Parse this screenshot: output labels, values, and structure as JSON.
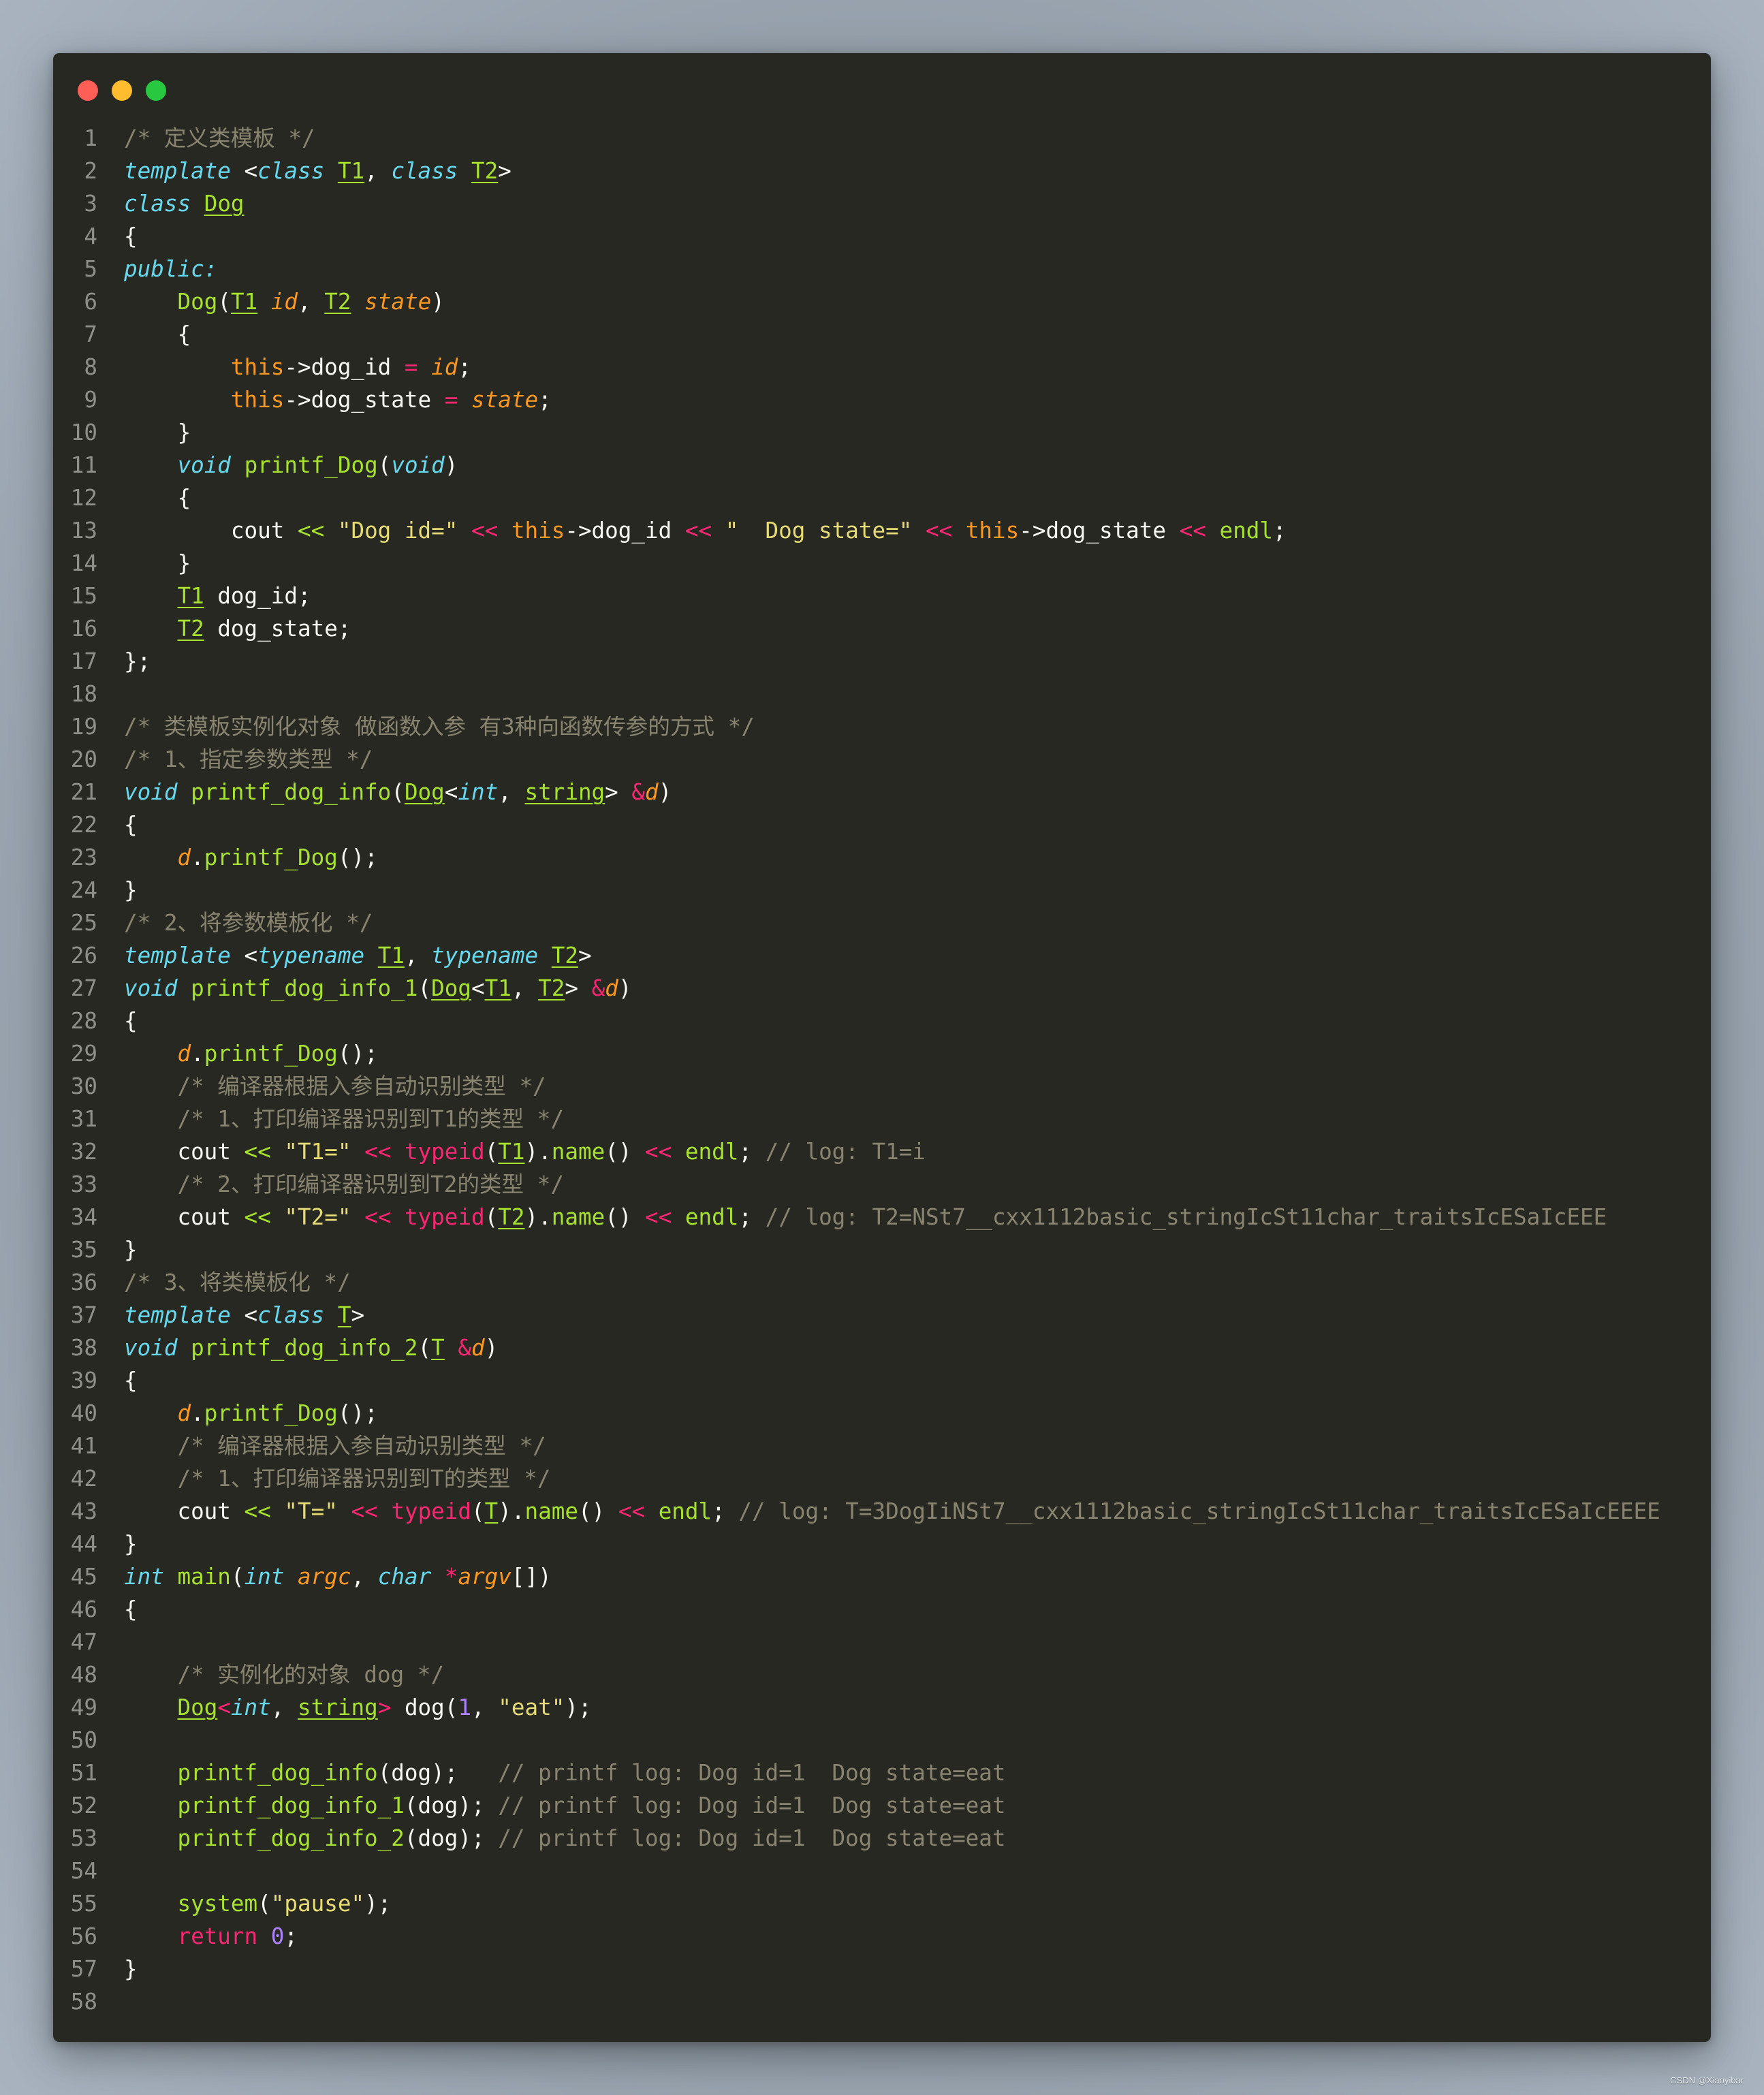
{
  "window": {
    "controls": [
      {
        "name": "close",
        "color": "#ff5f57"
      },
      {
        "name": "minimize",
        "color": "#febc2e"
      },
      {
        "name": "maximize",
        "color": "#28c840"
      }
    ]
  },
  "watermark": "CSDN @Xiaoyibar",
  "code": [
    [
      {
        "t": "/* 定义类模板 */",
        "c": "cm"
      }
    ],
    [
      {
        "t": "template",
        "c": "kw"
      },
      {
        "t": " <",
        "c": "pl"
      },
      {
        "t": "class",
        "c": "kw"
      },
      {
        "t": " ",
        "c": "pl"
      },
      {
        "t": "T1",
        "c": "ul"
      },
      {
        "t": ", ",
        "c": "pl"
      },
      {
        "t": "class",
        "c": "kw"
      },
      {
        "t": " ",
        "c": "pl"
      },
      {
        "t": "T2",
        "c": "ul"
      },
      {
        "t": ">",
        "c": "pl"
      }
    ],
    [
      {
        "t": "class",
        "c": "kw"
      },
      {
        "t": " ",
        "c": "pl"
      },
      {
        "t": "Dog",
        "c": "ul"
      }
    ],
    [
      {
        "t": "{",
        "c": "pl"
      }
    ],
    [
      {
        "t": "public:",
        "c": "kw"
      }
    ],
    [
      {
        "t": "    ",
        "c": "pl"
      },
      {
        "t": "Dog",
        "c": "fn"
      },
      {
        "t": "(",
        "c": "pl"
      },
      {
        "t": "T1",
        "c": "ul"
      },
      {
        "t": " ",
        "c": "pl"
      },
      {
        "t": "id",
        "c": "param"
      },
      {
        "t": ", ",
        "c": "pl"
      },
      {
        "t": "T2",
        "c": "ul"
      },
      {
        "t": " ",
        "c": "pl"
      },
      {
        "t": "state",
        "c": "param"
      },
      {
        "t": ")",
        "c": "pl"
      }
    ],
    [
      {
        "t": "    {",
        "c": "pl"
      }
    ],
    [
      {
        "t": "        ",
        "c": "pl"
      },
      {
        "t": "this",
        "c": "th"
      },
      {
        "t": "->dog_id ",
        "c": "pl"
      },
      {
        "t": "=",
        "c": "op"
      },
      {
        "t": " ",
        "c": "pl"
      },
      {
        "t": "id",
        "c": "param"
      },
      {
        "t": ";",
        "c": "pl"
      }
    ],
    [
      {
        "t": "        ",
        "c": "pl"
      },
      {
        "t": "this",
        "c": "th"
      },
      {
        "t": "->dog_state ",
        "c": "pl"
      },
      {
        "t": "=",
        "c": "op"
      },
      {
        "t": " ",
        "c": "pl"
      },
      {
        "t": "state",
        "c": "param"
      },
      {
        "t": ";",
        "c": "pl"
      }
    ],
    [
      {
        "t": "    }",
        "c": "pl"
      }
    ],
    [
      {
        "t": "    ",
        "c": "pl"
      },
      {
        "t": "void",
        "c": "kw"
      },
      {
        "t": " ",
        "c": "pl"
      },
      {
        "t": "printf_Dog",
        "c": "fn"
      },
      {
        "t": "(",
        "c": "pl"
      },
      {
        "t": "void",
        "c": "kw"
      },
      {
        "t": ")",
        "c": "pl"
      }
    ],
    [
      {
        "t": "    {",
        "c": "pl"
      }
    ],
    [
      {
        "t": "        cout ",
        "c": "pl"
      },
      {
        "t": "<<",
        "c": "gop"
      },
      {
        "t": " ",
        "c": "pl"
      },
      {
        "t": "\"Dog id=\"",
        "c": "str"
      },
      {
        "t": " ",
        "c": "pl"
      },
      {
        "t": "<<",
        "c": "op"
      },
      {
        "t": " ",
        "c": "pl"
      },
      {
        "t": "this",
        "c": "th"
      },
      {
        "t": "->dog_id ",
        "c": "pl"
      },
      {
        "t": "<<",
        "c": "op"
      },
      {
        "t": " ",
        "c": "pl"
      },
      {
        "t": "\"  Dog state=\"",
        "c": "str"
      },
      {
        "t": " ",
        "c": "pl"
      },
      {
        "t": "<<",
        "c": "op"
      },
      {
        "t": " ",
        "c": "pl"
      },
      {
        "t": "this",
        "c": "th"
      },
      {
        "t": "->dog_state ",
        "c": "pl"
      },
      {
        "t": "<<",
        "c": "op"
      },
      {
        "t": " ",
        "c": "pl"
      },
      {
        "t": "endl",
        "c": "fn"
      },
      {
        "t": ";",
        "c": "pl"
      }
    ],
    [
      {
        "t": "    }",
        "c": "pl"
      }
    ],
    [
      {
        "t": "    ",
        "c": "pl"
      },
      {
        "t": "T1",
        "c": "ul"
      },
      {
        "t": " dog_id;",
        "c": "pl"
      }
    ],
    [
      {
        "t": "    ",
        "c": "pl"
      },
      {
        "t": "T2",
        "c": "ul"
      },
      {
        "t": " dog_state;",
        "c": "pl"
      }
    ],
    [
      {
        "t": "};",
        "c": "pl"
      }
    ],
    [],
    [
      {
        "t": "/* 类模板实例化对象 做函数入参 有3种向函数传参的方式 */",
        "c": "cm"
      }
    ],
    [
      {
        "t": "/* 1、指定参数类型 */",
        "c": "cm"
      }
    ],
    [
      {
        "t": "void",
        "c": "kw"
      },
      {
        "t": " ",
        "c": "pl"
      },
      {
        "t": "printf_dog_info",
        "c": "fn"
      },
      {
        "t": "(",
        "c": "pl"
      },
      {
        "t": "Dog",
        "c": "ul"
      },
      {
        "t": "<",
        "c": "pl"
      },
      {
        "t": "int",
        "c": "kw"
      },
      {
        "t": ", ",
        "c": "pl"
      },
      {
        "t": "string",
        "c": "ul"
      },
      {
        "t": "> ",
        "c": "pl"
      },
      {
        "t": "&",
        "c": "op"
      },
      {
        "t": "d",
        "c": "param"
      },
      {
        "t": ")",
        "c": "pl"
      }
    ],
    [
      {
        "t": "{",
        "c": "pl"
      }
    ],
    [
      {
        "t": "    ",
        "c": "pl"
      },
      {
        "t": "d",
        "c": "param"
      },
      {
        "t": ".",
        "c": "pl"
      },
      {
        "t": "printf_Dog",
        "c": "fn"
      },
      {
        "t": "();",
        "c": "pl"
      }
    ],
    [
      {
        "t": "}",
        "c": "pl"
      }
    ],
    [
      {
        "t": "/* 2、将参数模板化 */",
        "c": "cm"
      }
    ],
    [
      {
        "t": "template",
        "c": "kw"
      },
      {
        "t": " <",
        "c": "pl"
      },
      {
        "t": "typename",
        "c": "kw"
      },
      {
        "t": " ",
        "c": "pl"
      },
      {
        "t": "T1",
        "c": "ul"
      },
      {
        "t": ", ",
        "c": "pl"
      },
      {
        "t": "typename",
        "c": "kw"
      },
      {
        "t": " ",
        "c": "pl"
      },
      {
        "t": "T2",
        "c": "ul"
      },
      {
        "t": ">",
        "c": "pl"
      }
    ],
    [
      {
        "t": "void",
        "c": "kw"
      },
      {
        "t": " ",
        "c": "pl"
      },
      {
        "t": "printf_dog_info_1",
        "c": "fn"
      },
      {
        "t": "(",
        "c": "pl"
      },
      {
        "t": "Dog",
        "c": "ul"
      },
      {
        "t": "<",
        "c": "pl"
      },
      {
        "t": "T1",
        "c": "ul"
      },
      {
        "t": ", ",
        "c": "pl"
      },
      {
        "t": "T2",
        "c": "ul"
      },
      {
        "t": "> ",
        "c": "pl"
      },
      {
        "t": "&",
        "c": "op"
      },
      {
        "t": "d",
        "c": "param"
      },
      {
        "t": ")",
        "c": "pl"
      }
    ],
    [
      {
        "t": "{",
        "c": "pl"
      }
    ],
    [
      {
        "t": "    ",
        "c": "pl"
      },
      {
        "t": "d",
        "c": "param"
      },
      {
        "t": ".",
        "c": "pl"
      },
      {
        "t": "printf_Dog",
        "c": "fn"
      },
      {
        "t": "();",
        "c": "pl"
      }
    ],
    [
      {
        "t": "    ",
        "c": "pl"
      },
      {
        "t": "/* 编译器根据入参自动识别类型 */",
        "c": "cm"
      }
    ],
    [
      {
        "t": "    ",
        "c": "pl"
      },
      {
        "t": "/* 1、打印编译器识别到T1的类型 */",
        "c": "cm"
      }
    ],
    [
      {
        "t": "    cout ",
        "c": "pl"
      },
      {
        "t": "<<",
        "c": "gop"
      },
      {
        "t": " ",
        "c": "pl"
      },
      {
        "t": "\"T1=\"",
        "c": "str"
      },
      {
        "t": " ",
        "c": "pl"
      },
      {
        "t": "<<",
        "c": "op"
      },
      {
        "t": " ",
        "c": "pl"
      },
      {
        "t": "typeid",
        "c": "op"
      },
      {
        "t": "(",
        "c": "pl"
      },
      {
        "t": "T1",
        "c": "ul"
      },
      {
        "t": ").",
        "c": "pl"
      },
      {
        "t": "name",
        "c": "fn"
      },
      {
        "t": "() ",
        "c": "pl"
      },
      {
        "t": "<<",
        "c": "op"
      },
      {
        "t": " ",
        "c": "pl"
      },
      {
        "t": "endl",
        "c": "fn"
      },
      {
        "t": "; ",
        "c": "pl"
      },
      {
        "t": "// log: T1=i",
        "c": "cm"
      }
    ],
    [
      {
        "t": "    ",
        "c": "pl"
      },
      {
        "t": "/* 2、打印编译器识别到T2的类型 */",
        "c": "cm"
      }
    ],
    [
      {
        "t": "    cout ",
        "c": "pl"
      },
      {
        "t": "<<",
        "c": "gop"
      },
      {
        "t": " ",
        "c": "pl"
      },
      {
        "t": "\"T2=\"",
        "c": "str"
      },
      {
        "t": " ",
        "c": "pl"
      },
      {
        "t": "<<",
        "c": "op"
      },
      {
        "t": " ",
        "c": "pl"
      },
      {
        "t": "typeid",
        "c": "op"
      },
      {
        "t": "(",
        "c": "pl"
      },
      {
        "t": "T2",
        "c": "ul"
      },
      {
        "t": ").",
        "c": "pl"
      },
      {
        "t": "name",
        "c": "fn"
      },
      {
        "t": "() ",
        "c": "pl"
      },
      {
        "t": "<<",
        "c": "op"
      },
      {
        "t": " ",
        "c": "pl"
      },
      {
        "t": "endl",
        "c": "fn"
      },
      {
        "t": "; ",
        "c": "pl"
      },
      {
        "t": "// log: T2=NSt7__cxx1112basic_stringIcSt11char_traitsIcESaIcEEE",
        "c": "cm"
      }
    ],
    [
      {
        "t": "}",
        "c": "pl"
      }
    ],
    [
      {
        "t": "/* 3、将类模板化 */",
        "c": "cm"
      }
    ],
    [
      {
        "t": "template",
        "c": "kw"
      },
      {
        "t": " <",
        "c": "pl"
      },
      {
        "t": "class",
        "c": "kw"
      },
      {
        "t": " ",
        "c": "pl"
      },
      {
        "t": "T",
        "c": "ul"
      },
      {
        "t": ">",
        "c": "pl"
      }
    ],
    [
      {
        "t": "void",
        "c": "kw"
      },
      {
        "t": " ",
        "c": "pl"
      },
      {
        "t": "printf_dog_info_2",
        "c": "fn"
      },
      {
        "t": "(",
        "c": "pl"
      },
      {
        "t": "T",
        "c": "ul"
      },
      {
        "t": " ",
        "c": "pl"
      },
      {
        "t": "&",
        "c": "op"
      },
      {
        "t": "d",
        "c": "param"
      },
      {
        "t": ")",
        "c": "pl"
      }
    ],
    [
      {
        "t": "{",
        "c": "pl"
      }
    ],
    [
      {
        "t": "    ",
        "c": "pl"
      },
      {
        "t": "d",
        "c": "param"
      },
      {
        "t": ".",
        "c": "pl"
      },
      {
        "t": "printf_Dog",
        "c": "fn"
      },
      {
        "t": "();",
        "c": "pl"
      }
    ],
    [
      {
        "t": "    ",
        "c": "pl"
      },
      {
        "t": "/* 编译器根据入参自动识别类型 */",
        "c": "cm"
      }
    ],
    [
      {
        "t": "    ",
        "c": "pl"
      },
      {
        "t": "/* 1、打印编译器识别到T的类型 */",
        "c": "cm"
      }
    ],
    [
      {
        "t": "    cout ",
        "c": "pl"
      },
      {
        "t": "<<",
        "c": "gop"
      },
      {
        "t": " ",
        "c": "pl"
      },
      {
        "t": "\"T=\"",
        "c": "str"
      },
      {
        "t": " ",
        "c": "pl"
      },
      {
        "t": "<<",
        "c": "op"
      },
      {
        "t": " ",
        "c": "pl"
      },
      {
        "t": "typeid",
        "c": "op"
      },
      {
        "t": "(",
        "c": "pl"
      },
      {
        "t": "T",
        "c": "ul"
      },
      {
        "t": ").",
        "c": "pl"
      },
      {
        "t": "name",
        "c": "fn"
      },
      {
        "t": "() ",
        "c": "pl"
      },
      {
        "t": "<<",
        "c": "op"
      },
      {
        "t": " ",
        "c": "pl"
      },
      {
        "t": "endl",
        "c": "fn"
      },
      {
        "t": "; ",
        "c": "pl"
      },
      {
        "t": "// log: T=3DogIiNSt7__cxx1112basic_stringIcSt11char_traitsIcESaIcEEEE",
        "c": "cm"
      }
    ],
    [
      {
        "t": "}",
        "c": "pl"
      }
    ],
    [
      {
        "t": "int",
        "c": "kw"
      },
      {
        "t": " ",
        "c": "pl"
      },
      {
        "t": "main",
        "c": "fn"
      },
      {
        "t": "(",
        "c": "pl"
      },
      {
        "t": "int",
        "c": "kw"
      },
      {
        "t": " ",
        "c": "pl"
      },
      {
        "t": "argc",
        "c": "param"
      },
      {
        "t": ", ",
        "c": "pl"
      },
      {
        "t": "char",
        "c": "kw"
      },
      {
        "t": " ",
        "c": "pl"
      },
      {
        "t": "*",
        "c": "op"
      },
      {
        "t": "argv",
        "c": "param"
      },
      {
        "t": "[])",
        "c": "pl"
      }
    ],
    [
      {
        "t": "{",
        "c": "pl"
      }
    ],
    [],
    [
      {
        "t": "    ",
        "c": "pl"
      },
      {
        "t": "/* 实例化的对象 dog */",
        "c": "cm"
      }
    ],
    [
      {
        "t": "    ",
        "c": "pl"
      },
      {
        "t": "Dog",
        "c": "ul"
      },
      {
        "t": "<",
        "c": "op"
      },
      {
        "t": "int",
        "c": "kw"
      },
      {
        "t": ", ",
        "c": "pl"
      },
      {
        "t": "string",
        "c": "ul"
      },
      {
        "t": ">",
        "c": "op"
      },
      {
        "t": " dog(",
        "c": "pl"
      },
      {
        "t": "1",
        "c": "num"
      },
      {
        "t": ", ",
        "c": "pl"
      },
      {
        "t": "\"eat\"",
        "c": "str"
      },
      {
        "t": ");",
        "c": "pl"
      }
    ],
    [],
    [
      {
        "t": "    ",
        "c": "pl"
      },
      {
        "t": "printf_dog_info",
        "c": "fn"
      },
      {
        "t": "(dog);   ",
        "c": "pl"
      },
      {
        "t": "// printf log: Dog id=1  Dog state=eat",
        "c": "cm"
      }
    ],
    [
      {
        "t": "    ",
        "c": "pl"
      },
      {
        "t": "printf_dog_info_1",
        "c": "fn"
      },
      {
        "t": "(dog); ",
        "c": "pl"
      },
      {
        "t": "// printf log: Dog id=1  Dog state=eat",
        "c": "cm"
      }
    ],
    [
      {
        "t": "    ",
        "c": "pl"
      },
      {
        "t": "printf_dog_info_2",
        "c": "fn"
      },
      {
        "t": "(dog); ",
        "c": "pl"
      },
      {
        "t": "// printf log: Dog id=1  Dog state=eat",
        "c": "cm"
      }
    ],
    [],
    [
      {
        "t": "    ",
        "c": "pl"
      },
      {
        "t": "system",
        "c": "fn"
      },
      {
        "t": "(",
        "c": "pl"
      },
      {
        "t": "\"pause\"",
        "c": "str"
      },
      {
        "t": ");",
        "c": "pl"
      }
    ],
    [
      {
        "t": "    ",
        "c": "pl"
      },
      {
        "t": "return",
        "c": "op"
      },
      {
        "t": " ",
        "c": "pl"
      },
      {
        "t": "0",
        "c": "num"
      },
      {
        "t": ";",
        "c": "pl"
      }
    ],
    [
      {
        "t": "}",
        "c": "pl"
      }
    ],
    []
  ]
}
